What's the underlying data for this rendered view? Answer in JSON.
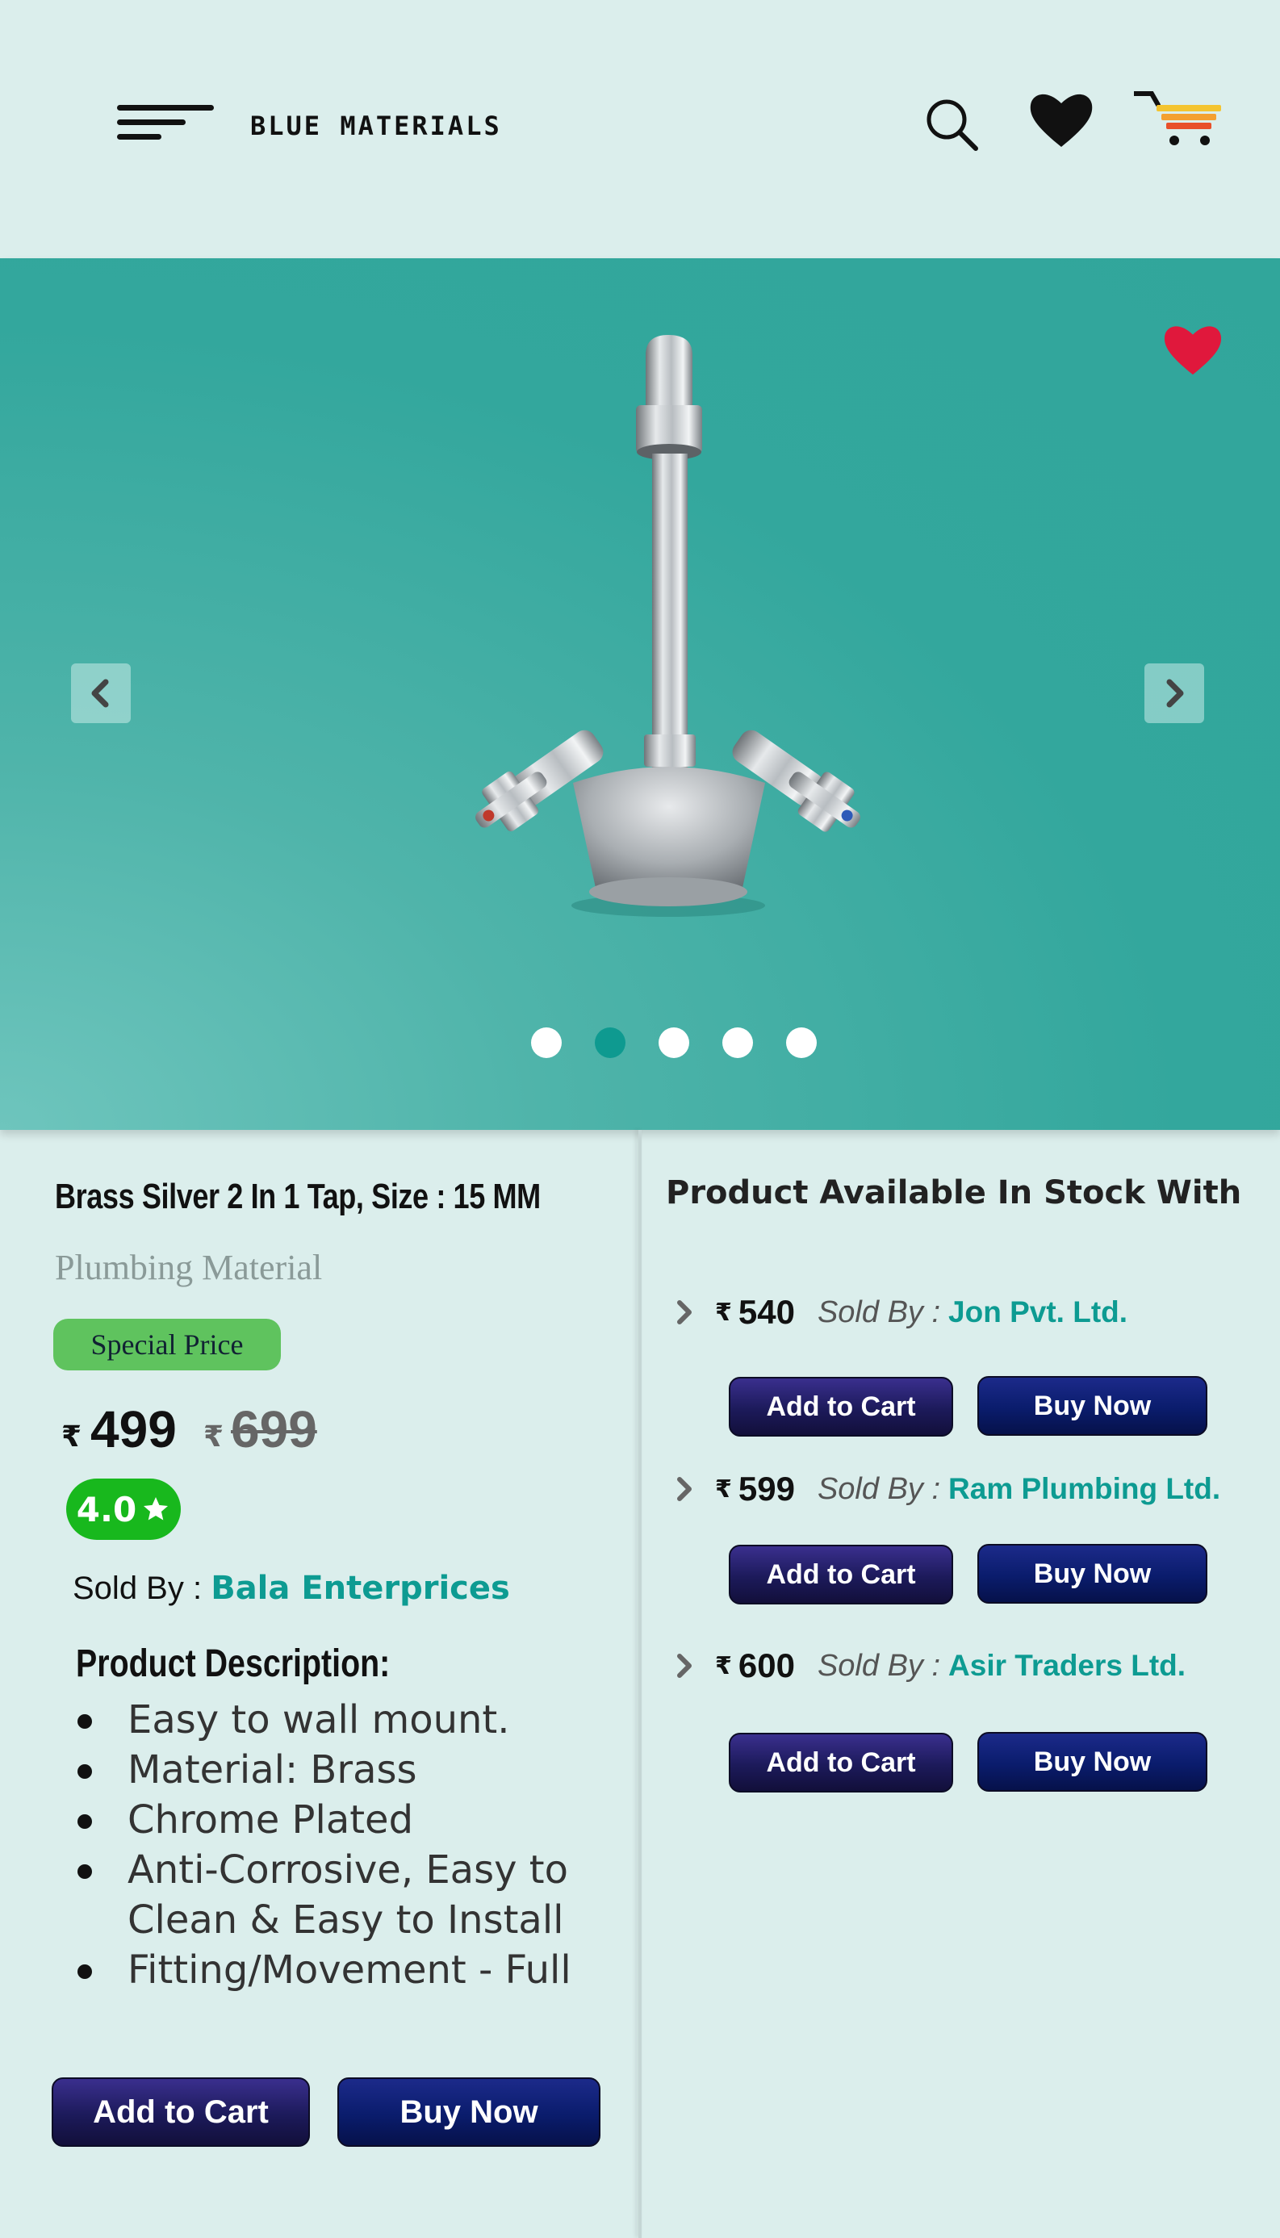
{
  "header": {
    "brand": "BLUE MATERIALS",
    "icons": [
      "menu-icon",
      "search-icon",
      "heart-icon",
      "cart-icon"
    ]
  },
  "carousel": {
    "image_alt": "Brass Silver 2 In 1 Tap",
    "slide_count": 5,
    "active_index": 1,
    "prev_icon": "chevron-left-icon",
    "next_icon": "chevron-right-icon",
    "favorite_icon": "heart-icon",
    "favorite_color": "#e0183c"
  },
  "product": {
    "title": "Brass Silver 2 In 1  Tap, Size : 15 MM",
    "category": "Plumbing Material",
    "badge": "Special Price",
    "currency": "₹",
    "price": "499",
    "old_price": "699",
    "rating": "4.0",
    "sold_by_label": "Sold By : ",
    "seller": "Bala Enterprices",
    "description_heading": "Product Description:",
    "description": [
      "Easy to wall mount.",
      "Material: Brass",
      "Chrome Plated",
      "Anti-Corrosive, Easy to Clean & Easy to Install",
      "Fitting/Movement - Full"
    ],
    "add_to_cart": "Add to Cart",
    "buy_now": "Buy Now"
  },
  "stock": {
    "heading": "Product Available In Stock With",
    "offers": [
      {
        "currency": "₹",
        "price": "540",
        "sold_by_label": "Sold By :",
        "seller": "Jon Pvt. Ltd.",
        "add_to_cart": "Add to Cart",
        "buy_now": "Buy Now"
      },
      {
        "currency": "₹",
        "price": "599",
        "sold_by_label": "Sold By :",
        "seller": "Ram Plumbing Ltd.",
        "add_to_cart": "Add to Cart",
        "buy_now": "Buy Now"
      },
      {
        "currency": "₹",
        "price": "600",
        "sold_by_label": "Sold By :",
        "seller": "Asir Traders Ltd.",
        "add_to_cart": "Add to Cart",
        "buy_now": "Buy Now"
      }
    ]
  },
  "colors": {
    "background": "#dbeeec",
    "hero": "#33a79d",
    "accent_teal": "#0d9b92",
    "badge_green": "#5fc35e",
    "rating_green": "#18b81d",
    "button_cart": "#1c1a5a",
    "button_buy": "#0a1c6c"
  }
}
